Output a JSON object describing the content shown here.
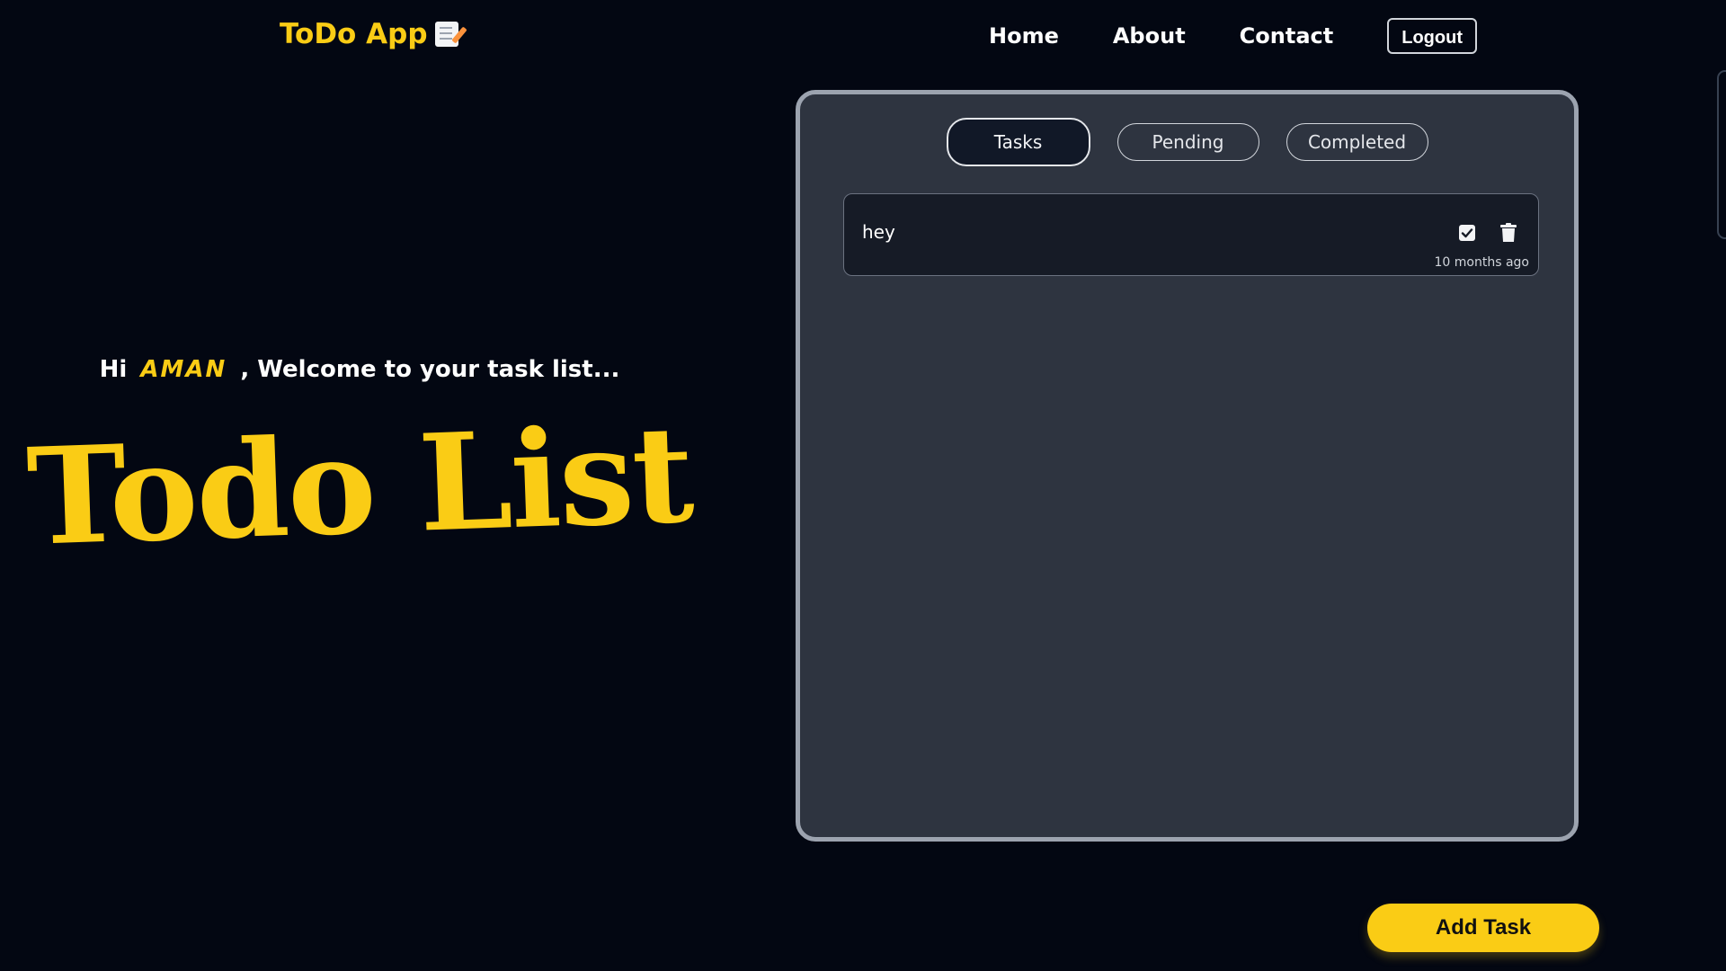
{
  "header": {
    "brand": "ToDo App",
    "brand_icon": "memo-icon",
    "nav": [
      {
        "label": "Home"
      },
      {
        "label": "About"
      },
      {
        "label": "Contact"
      }
    ],
    "logout_label": "Logout"
  },
  "hero": {
    "greeting_prefix": "Hi",
    "username": "AMAN",
    "greeting_suffix": ", Welcome to your task list...",
    "title": "Todo List"
  },
  "panel": {
    "tabs": [
      {
        "label": "Tasks",
        "active": true
      },
      {
        "label": "Pending",
        "active": false
      },
      {
        "label": "Completed",
        "active": false
      }
    ],
    "tasks": [
      {
        "text": "hey",
        "time": "10 months ago"
      }
    ]
  },
  "add_task_label": "Add Task",
  "colors": {
    "accent": "#facc15",
    "background": "#030712",
    "panel": "#2e3440"
  }
}
